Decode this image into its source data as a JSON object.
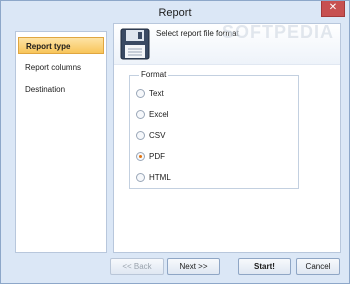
{
  "window": {
    "title": "Report",
    "close_glyph": "✕"
  },
  "sidebar": {
    "items": [
      {
        "label": "Report type",
        "active": true
      },
      {
        "label": "Report columns",
        "active": false
      },
      {
        "label": "Destination",
        "active": false
      }
    ]
  },
  "content": {
    "header_text": "Select report file format",
    "watermark": "SOFTPEDIA",
    "group_title": "Format",
    "options": [
      {
        "label": "Text",
        "checked": false
      },
      {
        "label": "Excel",
        "checked": false
      },
      {
        "label": "CSV",
        "checked": false
      },
      {
        "label": "PDF",
        "checked": true
      },
      {
        "label": "HTML",
        "checked": false
      }
    ]
  },
  "footer": {
    "back_label": "<< Back",
    "next_label": "Next >>",
    "start_label": "Start!",
    "cancel_label": "Cancel"
  },
  "colors": {
    "accent": "#e2740f",
    "selected_nav": "#f8c55b",
    "close": "#c75050"
  },
  "icons": {
    "header": "floppy-disk-icon",
    "close": "close-icon"
  }
}
